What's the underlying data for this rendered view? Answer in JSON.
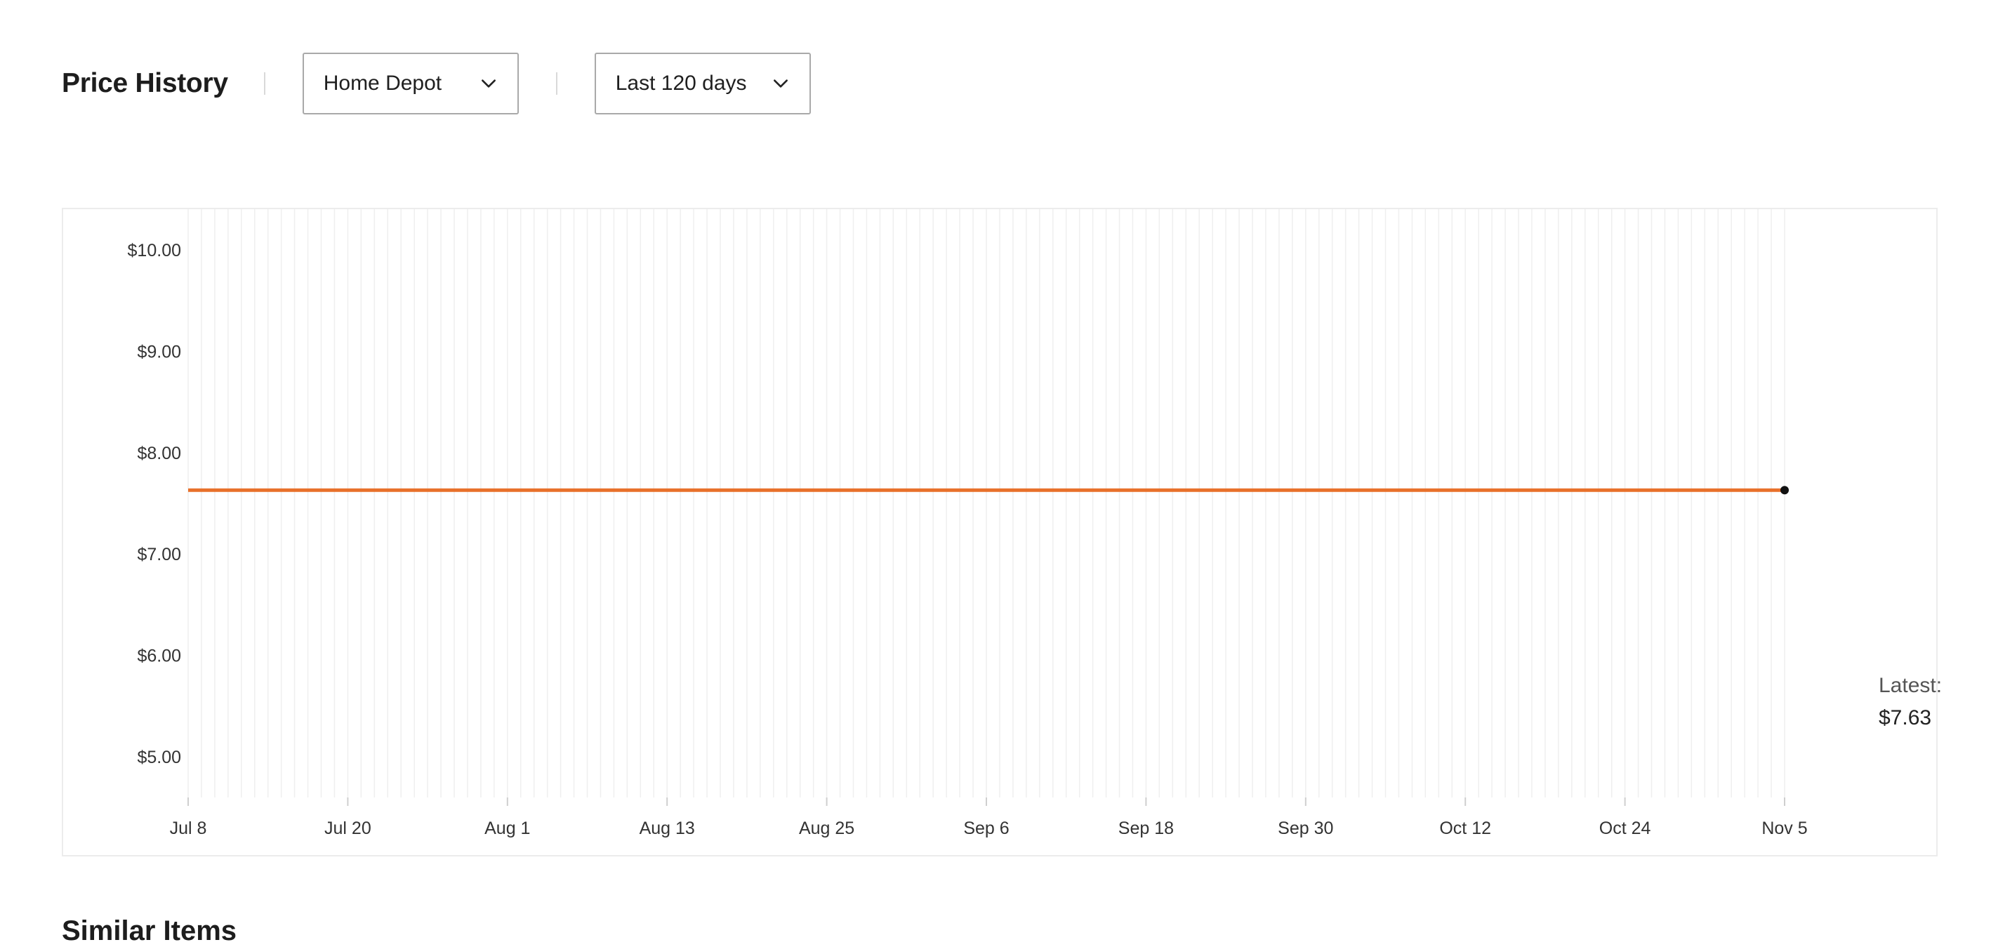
{
  "header": {
    "title": "Price History",
    "store_dropdown": {
      "selected": "Home Depot"
    },
    "range_dropdown": {
      "selected": "Last 120 days"
    }
  },
  "colors": {
    "price_line": "#e8702a",
    "latest_dot": "#111111",
    "grid": "#efefef"
  },
  "chart_data": {
    "type": "line",
    "title": "",
    "xlabel": "",
    "ylabel": "",
    "ylim": [
      4.6,
      10.4
    ],
    "y_ticks": [
      10.0,
      9.0,
      8.0,
      7.0,
      6.0,
      5.0
    ],
    "y_tick_labels": [
      "$10.00",
      "$9.00",
      "$8.00",
      "$7.00",
      "$6.00",
      "$5.00"
    ],
    "x_range": [
      "Jul 8",
      "Nov 5"
    ],
    "x_ticks": [
      "Jul 8",
      "Jul 20",
      "Aug 1",
      "Aug 13",
      "Aug 25",
      "Sep 6",
      "Sep 18",
      "Sep 30",
      "Oct 12",
      "Oct 24",
      "Nov 5"
    ],
    "grid": "vertical daily lines",
    "series": [
      {
        "points": [
          [
            "Jul 8",
            7.63
          ],
          [
            "Nov 5",
            7.63
          ]
        ]
      }
    ],
    "annotation": {
      "label": "Latest:",
      "value": "$7.63",
      "x": "Nov 5",
      "y": 7.63
    }
  },
  "next_section": {
    "title": "Similar Items"
  }
}
